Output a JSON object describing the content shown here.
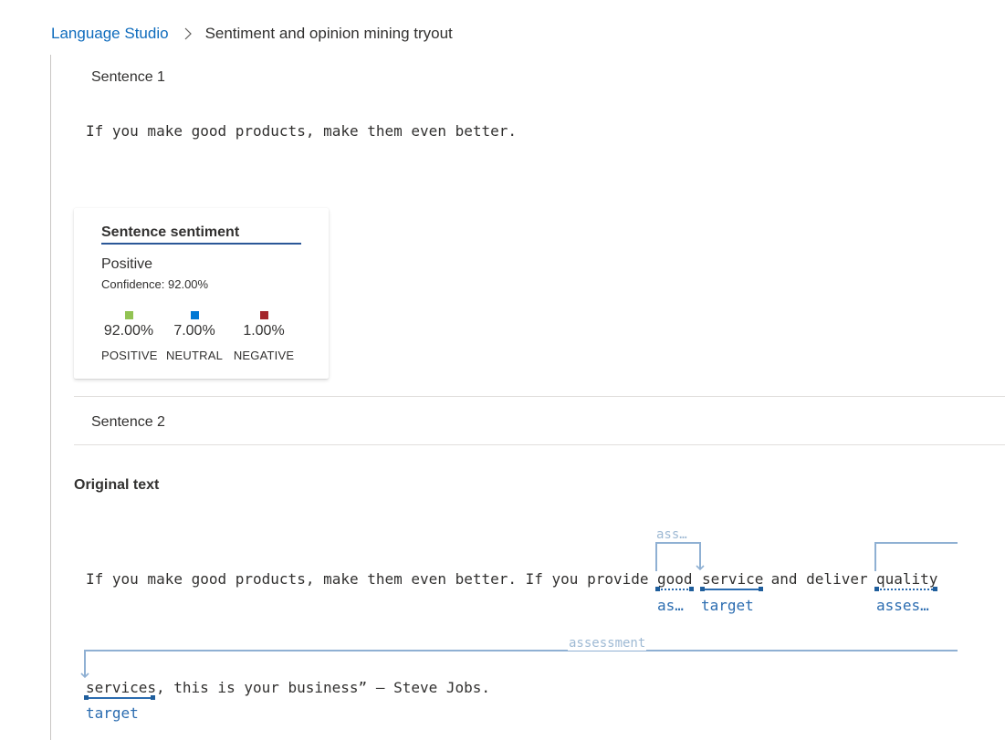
{
  "breadcrumb": {
    "root": "Language Studio",
    "separator_icon": "chevron-right-icon",
    "current": "Sentiment and opinion mining tryout"
  },
  "sentence1": {
    "header": "Sentence 1",
    "text": "If you make good products, make them even better.",
    "card": {
      "title": "Sentence sentiment",
      "label": "Positive",
      "confidence": "Confidence: 92.00%",
      "scores": [
        {
          "pct": "92.00%",
          "label": "POSITIVE",
          "color": "#92c353"
        },
        {
          "pct": "7.00%",
          "label": "NEUTRAL",
          "color": "#0078d4"
        },
        {
          "pct": "1.00%",
          "label": "NEGATIVE",
          "color": "#a4262c"
        }
      ]
    }
  },
  "sentence2": {
    "header": "Sentence 2"
  },
  "original": {
    "title": "Original text",
    "line1_prefix": "If you make good products, make them even better. If you provide ",
    "words": {
      "good": "good",
      "service": "service",
      "and_deliver": " and deliver ",
      "quality": "quality",
      "services": "services"
    },
    "line2_suffix": ", this is your business” – Steve Jobs.",
    "tags": {
      "good": "as…",
      "service": "target",
      "quality": "asses…",
      "services": "target"
    },
    "arc_labels": {
      "arc1": "ass…",
      "arc2": "assessment"
    }
  },
  "colors": {
    "link": "#0f6cbd",
    "annotation": "#2b6cb0",
    "arc": "#8fb0d3"
  }
}
